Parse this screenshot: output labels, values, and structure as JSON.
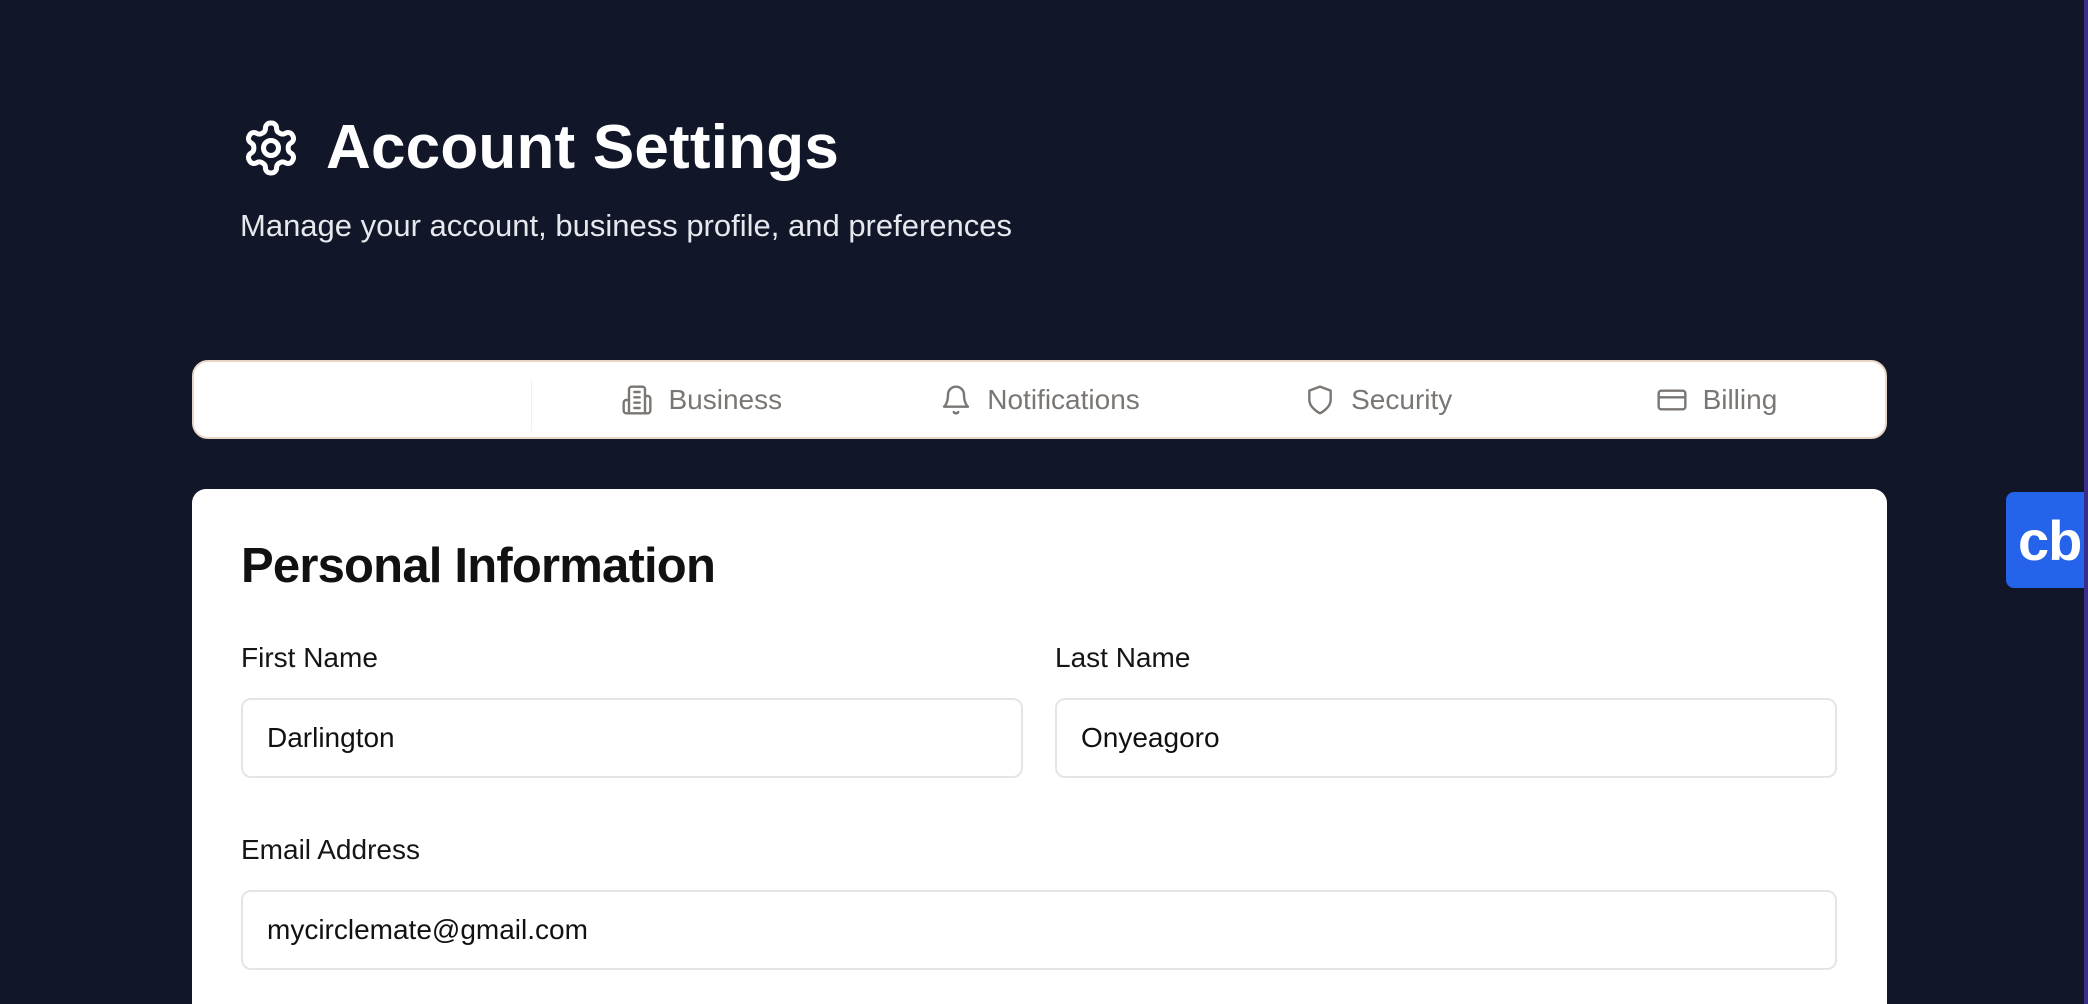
{
  "header": {
    "title": "Account Settings",
    "subtitle": "Manage your account, business profile, and preferences",
    "icon": "gear-icon"
  },
  "tabs": [
    {
      "label": "",
      "icon": "",
      "active": true
    },
    {
      "label": "Business",
      "icon": "building-icon",
      "active": false
    },
    {
      "label": "Notifications",
      "icon": "bell-icon",
      "active": false
    },
    {
      "label": "Security",
      "icon": "shield-icon",
      "active": false
    },
    {
      "label": "Billing",
      "icon": "credit-card-icon",
      "active": false
    }
  ],
  "personal_info": {
    "title": "Personal Information",
    "first_name": {
      "label": "First Name",
      "value": "Darlington"
    },
    "last_name": {
      "label": "Last Name",
      "value": "Onyeagoro"
    },
    "email": {
      "label": "Email Address",
      "value": "mycirclemate@gmail.com"
    }
  },
  "widget": {
    "label": "cb",
    "color": "#2563eb"
  },
  "colors": {
    "background": "#111729",
    "card": "#ffffff",
    "tab_text": "#7a7673",
    "tab_border": "#e9d6c6"
  }
}
